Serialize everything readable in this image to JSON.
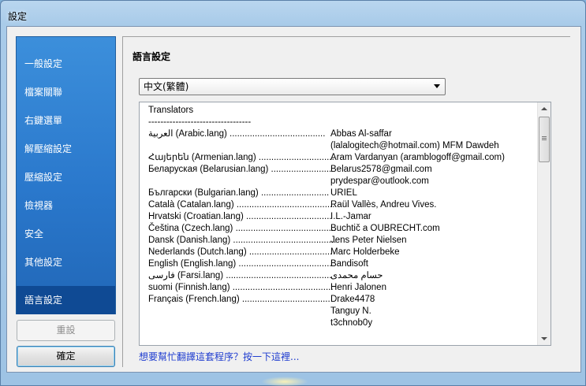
{
  "window": {
    "title": "設定"
  },
  "sidebar": {
    "items": [
      {
        "label": "一般設定"
      },
      {
        "label": "檔案關聯"
      },
      {
        "label": "右鍵選單"
      },
      {
        "label": "解壓縮設定"
      },
      {
        "label": "壓縮設定"
      },
      {
        "label": "檢視器"
      },
      {
        "label": "安全"
      },
      {
        "label": "其他設定"
      },
      {
        "label": "語言設定",
        "active": true
      }
    ]
  },
  "buttons": {
    "reset": "重設",
    "ok": "確定"
  },
  "panel": {
    "title": "語言設定",
    "language_select": {
      "value": "中文(繁體)"
    },
    "translators": {
      "heading": "Translators",
      "separator": "----------------------------------",
      "lines": [
        {
          "left": "العربية (Arabic.lang) ......................................",
          "right": "Abbas Al-saffar"
        },
        {
          "left": "",
          "right": "(lalalogitech@hotmail.com) MFM Dawdeh"
        },
        {
          "left": "Հայերեն (Armenian.lang) ..............................",
          "right": "Aram Vardanyan (aramblogoff@gmail.com)"
        },
        {
          "left": "Беларуская (Belarusian.lang) ........................",
          "right": "Belarus2578@gmail.com"
        },
        {
          "left": "",
          "right": "prydespar@outlook.com"
        },
        {
          "left": "Български (Bulgarian.lang) ...........................",
          "right": "URIEL"
        },
        {
          "left": "Català (Catalan.lang) .......................................",
          "right": "Raül Vallès, Andreu Vives."
        },
        {
          "left": "Hrvatski (Croatian.lang) ..................................",
          "right": "I.L.-Jamar"
        },
        {
          "left": "Čeština (Czech.lang) ........................................",
          "right": "Buchtič a OUBRECHT.com"
        },
        {
          "left": "Dansk (Danish.lang) .........................................",
          "right": "Jens Peter Nielsen"
        },
        {
          "left": "Nederlands (Dutch.lang) .................................",
          "right": "Marc Holderbeke"
        },
        {
          "left": "English (English.lang) .....................................",
          "right": "Bandisoft"
        },
        {
          "left": "فارسی (Farsi.lang) ..........................................",
          "right": "حسام محمدی"
        },
        {
          "left": "suomi (Finnish.lang) ........................................",
          "right": "Henri Jalonen"
        },
        {
          "left": "Français (French.lang) ...................................",
          "right": "Drake4478"
        },
        {
          "left": "",
          "right": "Tanguy N."
        },
        {
          "left": "",
          "right": "t3chnob0y"
        }
      ]
    },
    "help_link": "想要幫忙翻譯這套程序？按一下這裡..."
  }
}
